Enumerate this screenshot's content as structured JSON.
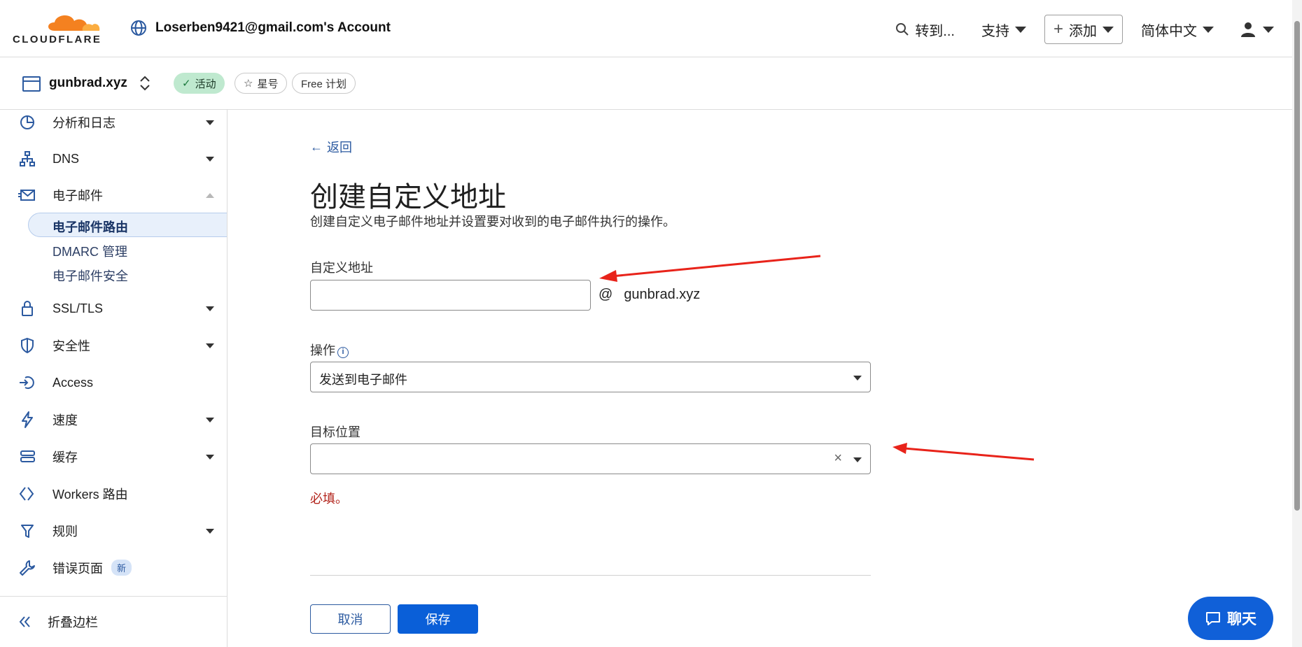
{
  "header": {
    "logo_text": "CLOUDFLARE",
    "account_name": "Loserben9421@gmail.com's Account",
    "goto_label": "转到...",
    "support_label": "支持",
    "add_label": "添加",
    "language_label": "简体中文"
  },
  "zone": {
    "name": "gunbrad.xyz",
    "status": "活动",
    "star_label": "星号",
    "plan_label": "Free 计划"
  },
  "sidebar": {
    "items": [
      {
        "label": "分析和日志"
      },
      {
        "label": "DNS"
      },
      {
        "label": "电子邮件"
      },
      {
        "label": "SSL/TLS"
      },
      {
        "label": "安全性"
      },
      {
        "label": "Access"
      },
      {
        "label": "速度"
      },
      {
        "label": "缓存"
      },
      {
        "label": "Workers 路由"
      },
      {
        "label": "规则"
      },
      {
        "label": "错误页面",
        "badge": "新"
      }
    ],
    "email_subitems": [
      "电子邮件路由",
      "DMARC 管理",
      "电子邮件安全"
    ],
    "collapse_label": "折叠边栏"
  },
  "main": {
    "back_label": "返回",
    "title": "创建自定义地址",
    "subtitle": "创建自定义电子邮件地址并设置要对收到的电子邮件执行的操作。",
    "custom_address_label": "自定义地址",
    "custom_address_value": "",
    "at_symbol": "@",
    "domain": "gunbrad.xyz",
    "action_label": "操作",
    "action_value": "发送到电子邮件",
    "destination_label": "目标位置",
    "destination_value": "",
    "error_text": "必填。",
    "cancel_label": "取消",
    "save_label": "保存"
  },
  "chat": {
    "label": "聊天"
  },
  "colors": {
    "brand_orange": "#f48120",
    "primary_blue": "#0a5fd8",
    "link_blue": "#2c5aa0",
    "error_red": "#b3261e",
    "annotation_red": "#e8231a"
  }
}
